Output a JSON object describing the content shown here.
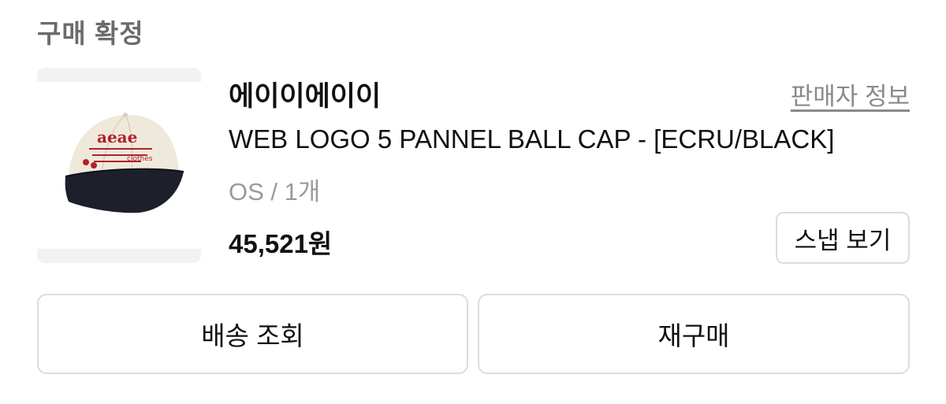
{
  "order": {
    "status_label": "구매 확정",
    "brand": "에이이에이이",
    "seller_info_link": "판매자 정보",
    "product_name": "WEB LOGO 5 PANNEL BALL CAP - [ECRU/BLACK]",
    "option": "OS / 1개",
    "price": "45,521원",
    "snap_button": "스냅 보기",
    "product_image_icon": "cap-photo",
    "product_image_text": [
      "aeae",
      "clothes"
    ]
  },
  "actions": {
    "shipping_label": "배송 조회",
    "rebuy_label": "재구매"
  },
  "colors": {
    "muted_text": "#8a8a8a",
    "border": "#dcdcdc",
    "cap_ecru": "#efe9dc",
    "cap_black": "#1d1f2b",
    "cap_logo_red": "#b3202a"
  }
}
